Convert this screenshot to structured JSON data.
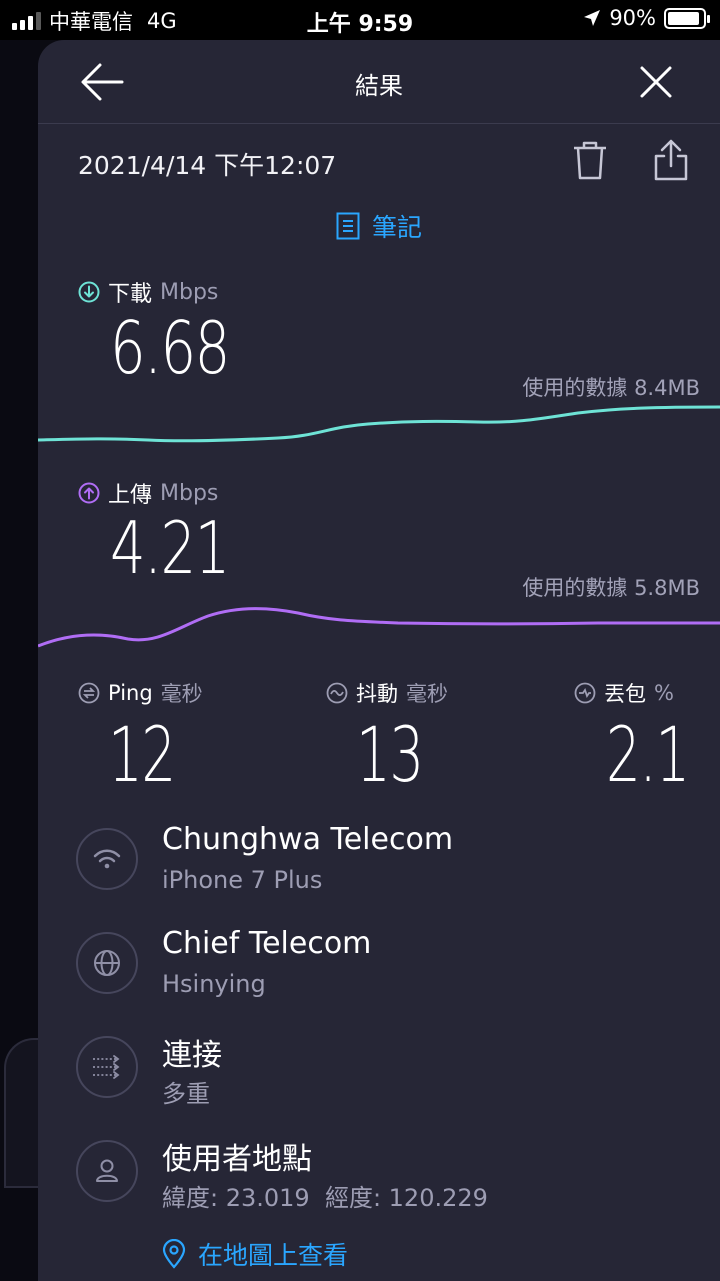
{
  "status_bar": {
    "carrier": "中華電信",
    "network": "4G",
    "time": "上午 9:59",
    "battery": "90%",
    "battery_level": 0.9
  },
  "header": {
    "title": "結果",
    "back_icon": "arrow-left-icon",
    "close_icon": "close-icon"
  },
  "result": {
    "datetime": "2021/4/14 下午12:07",
    "notes_label": "筆記"
  },
  "download": {
    "label": "下載",
    "unit": "Mbps",
    "value": "6.68",
    "usage_label": "使用的數據 8.4MB",
    "color": "#6ee3d6"
  },
  "upload": {
    "label": "上傳",
    "unit": "Mbps",
    "value": "4.21",
    "usage_label": "使用的數據 5.8MB",
    "color": "#b06df5"
  },
  "stats": [
    {
      "label": "Ping",
      "unit": "毫秒",
      "value": "12",
      "icon": "ping-icon"
    },
    {
      "label": "抖動",
      "unit": "毫秒",
      "value": "13",
      "icon": "jitter-icon"
    },
    {
      "label": "丟包",
      "unit": "%",
      "value": "2.1",
      "icon": "packet-loss-icon"
    }
  ],
  "info": [
    {
      "title": "Chunghwa Telecom",
      "subtitle": "iPhone 7 Plus",
      "icon": "wifi-icon"
    },
    {
      "title": "Chief Telecom",
      "subtitle": "Hsinying",
      "icon": "globe-icon"
    },
    {
      "title": "連接",
      "subtitle": "多重",
      "icon": "connections-icon"
    },
    {
      "title": "使用者地點",
      "subtitle": "緯度: 23.019  經度: 120.229",
      "icon": "user-icon"
    }
  ],
  "map_link": "在地圖上查看",
  "colors": {
    "accent": "#2aa6ff",
    "sheet_bg": "#262636"
  }
}
